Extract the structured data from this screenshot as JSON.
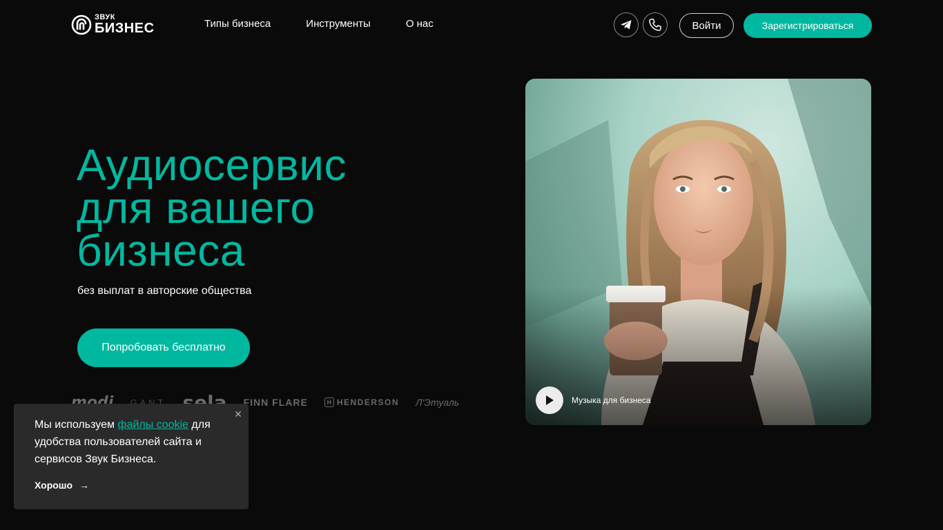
{
  "brand": {
    "small": "ЗВУК",
    "big": "БИЗНЕС"
  },
  "nav": {
    "items": [
      {
        "label": "Типы бизнеса"
      },
      {
        "label": "Инструменты"
      },
      {
        "label": "О нас"
      }
    ]
  },
  "header": {
    "telegram_icon": "telegram-icon",
    "phone_icon": "phone-icon",
    "login_label": "Войти",
    "register_label": "Зарегистрироваться"
  },
  "hero": {
    "title_lines": [
      "Аудиосервис",
      "для вашего",
      "бизнеса"
    ],
    "subtitle": "без выплат в авторские общества",
    "cta_label": "Попробовать бесплатно"
  },
  "brands": {
    "items": [
      "modi",
      "GANT",
      "sela",
      "FINN FLARE",
      "HENDERSON",
      "Л'Этуаль"
    ]
  },
  "player": {
    "caption": "Музыка для бизнеса",
    "icon": "play-icon"
  },
  "cookie": {
    "text_before": "Мы используем ",
    "link_label": "файлы cookie",
    "text_after": " для удобства пользователей сайта и сервисов Звук Бизнеса.",
    "ok_label": "Хорошо",
    "ok_arrow": "→",
    "close_icon": "close-icon"
  },
  "colors": {
    "accent": "#00b8a0",
    "background": "#0a0a0a",
    "cookie_bg": "#2a2a2a"
  }
}
